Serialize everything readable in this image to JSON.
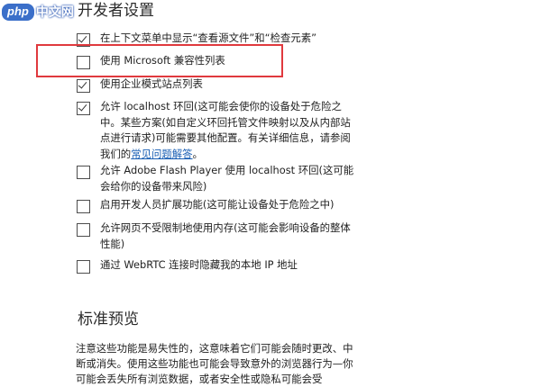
{
  "watermark": {
    "logo": "php",
    "site": "中文网"
  },
  "page_title": "开发者设置",
  "options": [
    {
      "label": "在上下文菜单中显示“查看源文件”和“检查元素”",
      "checked": true
    },
    {
      "label": "使用 Microsoft 兼容性列表",
      "checked": false
    },
    {
      "label": "使用企业模式站点列表",
      "checked": true
    },
    {
      "label_before_link": "允许 localhost 环回(这可能会使你的设备处于危险之中。某些方案(如自定义环回托管文件映射以及从内部站点进行请求)可能需要其他配置。有关详细信息，请参阅我们的",
      "link": "常见问题解答",
      "label_after_link": "。",
      "checked": true
    },
    {
      "label": "允许 Adobe Flash Player 使用 localhost 环回(这可能会给你的设备带来风险)",
      "checked": false
    },
    {
      "label": "启用开发人员扩展功能(这可能让设备处于危险之中)",
      "checked": false
    },
    {
      "label": "允许网页不受限制地使用内存(这可能会影响设备的整体性能)",
      "checked": false
    },
    {
      "label": "通过 WebRTC 连接时隐藏我的本地 IP 地址",
      "checked": false
    }
  ],
  "section_title": "标准预览",
  "note": "注意这些功能是易失性的，这意味着它们可能会随时更改、中断或消失。使用这些功能也可能会导致意外的浏览器行为—你可能会丢失所有浏览数据，或者安全性或隐私可能会受"
}
